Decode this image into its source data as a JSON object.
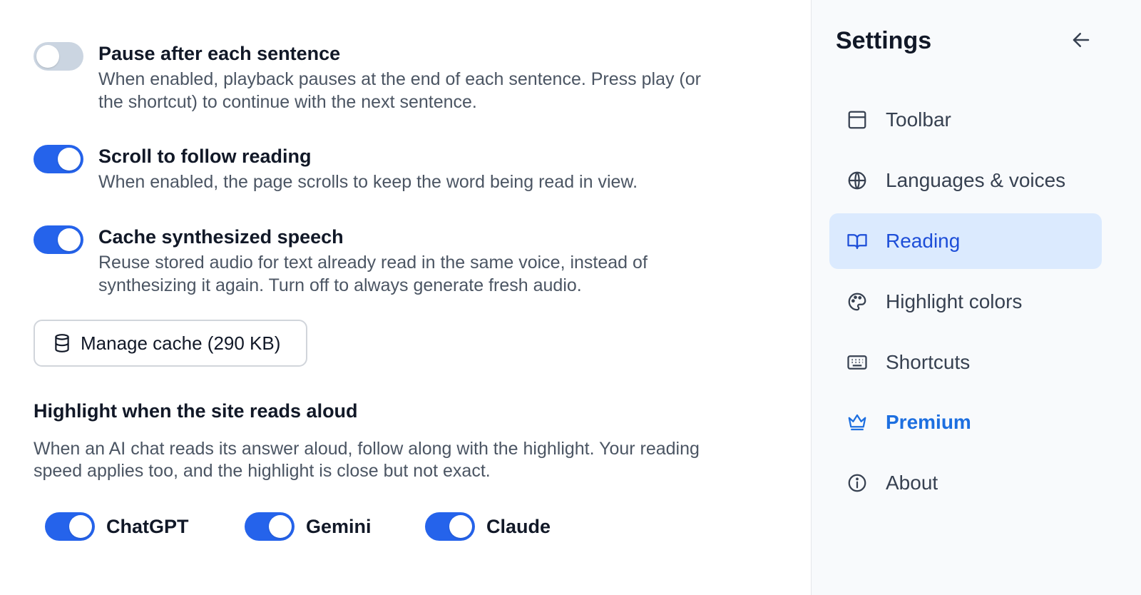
{
  "main": {
    "settings": [
      {
        "title": "Pause after each sentence",
        "description_lines": [
          "When enabled, playback pauses at the end of each sentence. Press play (or",
          "the shortcut) to continue with the next sentence."
        ],
        "enabled": false
      },
      {
        "title": "Scroll to follow reading",
        "description_lines": [
          "When enabled, the page scrolls to keep the word being read in view."
        ],
        "enabled": true
      },
      {
        "title": "Cache synthesized speech",
        "description_lines": [
          "Reuse stored audio for text already read in the same voice, instead of",
          "synthesizing it again. Turn off to always generate fresh audio."
        ],
        "enabled": true
      }
    ],
    "manage_cache_label": "Manage cache (290 KB)",
    "manage_cache_icon": "database-icon",
    "highlight_section": {
      "title": "Highlight when the site reads aloud",
      "description_lines": [
        "When an AI chat reads its answer aloud, follow along with the highlight. Your reading",
        "speed applies too, and the highlight is close but not exact."
      ],
      "sites": [
        {
          "label": "ChatGPT",
          "enabled": true
        },
        {
          "label": "Gemini",
          "enabled": true
        },
        {
          "label": "Claude",
          "enabled": true
        }
      ]
    }
  },
  "sidebar": {
    "title": "Settings",
    "back_icon": "arrow-left-icon",
    "items": [
      {
        "label": "Toolbar",
        "icon": "toolbar-icon",
        "active": false
      },
      {
        "label": "Languages & voices",
        "icon": "globe-icon",
        "active": false
      },
      {
        "label": "Reading",
        "icon": "book-icon",
        "active": true
      },
      {
        "label": "Highlight colors",
        "icon": "palette-icon",
        "active": false
      },
      {
        "label": "Shortcuts",
        "icon": "keyboard-icon",
        "active": false
      },
      {
        "label": "Premium",
        "icon": "crown-icon",
        "active": false,
        "premium": true
      },
      {
        "label": "About",
        "icon": "info-icon",
        "active": false
      }
    ]
  },
  "colors": {
    "accent": "#2563eb",
    "toggle_off": "#cbd5e1",
    "active_nav_bg": "#dbeafe",
    "active_nav_text": "#1d4ed8",
    "premium_text": "#1d6fe0",
    "sidebar_bg": "#f8fafc"
  }
}
